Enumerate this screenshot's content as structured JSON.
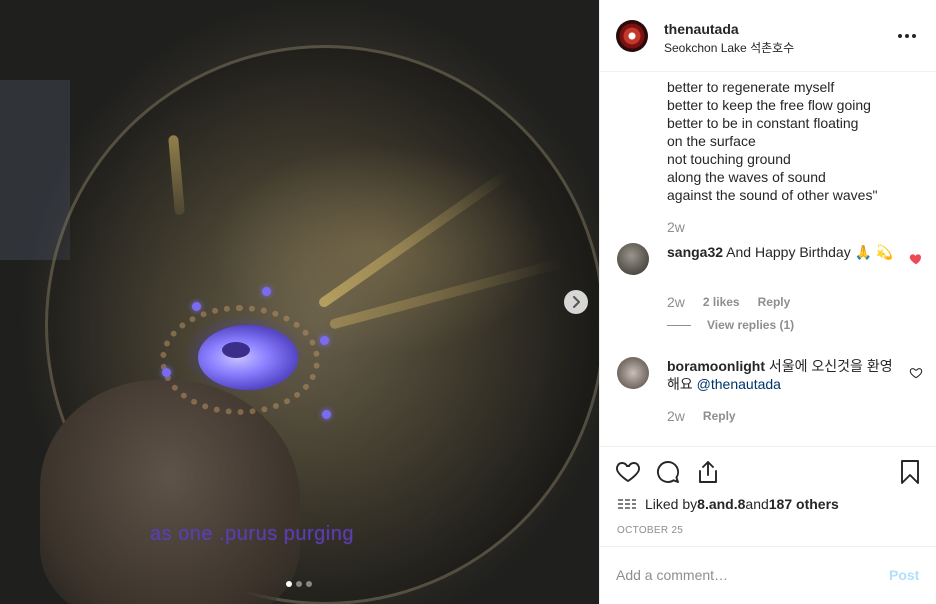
{
  "media": {
    "caption_overlay": "as one .purus purging",
    "carousel": {
      "total": 3,
      "active_index": 0
    },
    "next_icon": "chevron-right-icon"
  },
  "post": {
    "username": "thenautada",
    "location": "Seokchon Lake 석촌호수",
    "more_icon": "more-horizontal-icon",
    "caption_lines": [
      "better to regenerate myself",
      "better to keep the free flow going",
      "better to be in constant floating",
      "on the surface",
      "not touching ground",
      "along the waves of sound",
      "against the sound of other waves\""
    ],
    "caption_time": "2w"
  },
  "comments": [
    {
      "username": "sanga32",
      "text": "And Happy Birthday 🙏 💫",
      "time": "2w",
      "likes": "2 likes",
      "reply_label": "Reply",
      "view_replies": "View replies (1)",
      "liked": true
    },
    {
      "username": "boramoonlight",
      "text": "서울에 오신것을 환영해요 ",
      "mention": "@thenautada",
      "time": "2w",
      "reply_label": "Reply",
      "liked": false
    }
  ],
  "actions": {
    "icons": [
      "heart-icon",
      "comment-icon",
      "share-icon",
      "bookmark-icon"
    ],
    "liked_by_prefix": "Liked by ",
    "liked_by_user": "8.and.8",
    "liked_by_and": " and ",
    "liked_by_others": "187 others",
    "date": "OCTOBER 25"
  },
  "add_comment": {
    "placeholder": "Add a comment…",
    "post_label": "Post"
  },
  "colors": {
    "heart_liked": "#ed4956",
    "link": "#003569",
    "post_disabled": "#b2dffc",
    "muted": "#8e8e8e"
  }
}
